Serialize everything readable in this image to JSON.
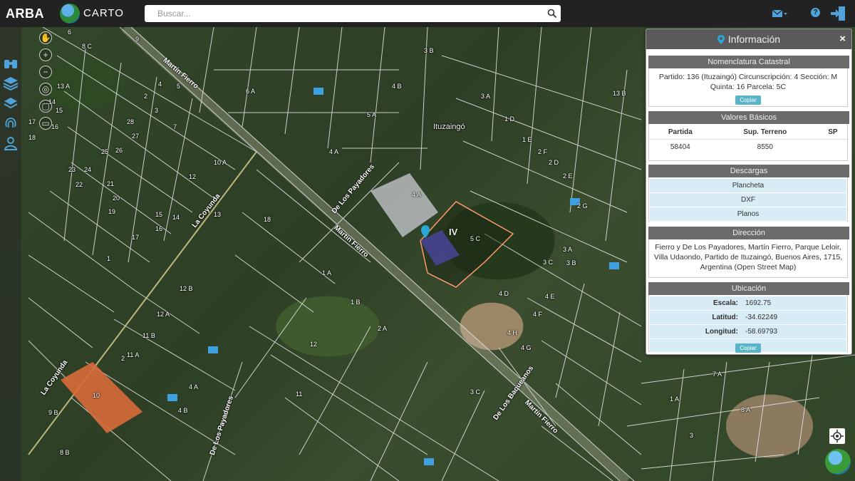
{
  "app": {
    "brand": "ARBA",
    "carto_name": "CARTO",
    "search_placeholder": "Buscar...",
    "icons": {
      "search": "search-icon",
      "mail": "mail-icon",
      "help": "help-icon",
      "logout": "logout-icon"
    },
    "help_glyph": "?",
    "colors": {
      "topbar": "#222222",
      "accent": "#4fa3d8",
      "panel_header": "#5a5a5a"
    }
  },
  "toolbar": {
    "items": [
      "binoculars-icon",
      "layers-icon",
      "layers-stack-icon",
      "fingerprint-icon",
      "user-location-icon"
    ]
  },
  "map": {
    "locality": "Ituzaingó",
    "zone": "IV",
    "streets": [
      "Martín Fierro",
      "La Coyunda",
      "De Los Payadores",
      "Martín Fierro",
      "De Los Payadores",
      "De Los Baqueanos",
      "Martín Fierro",
      "La Coyunda"
    ],
    "parcels": [
      "6",
      "8 C",
      "9",
      "13 A",
      "14",
      "15",
      "16",
      "17",
      "18",
      "4",
      "5",
      "3",
      "2",
      "28",
      "27",
      "26",
      "25",
      "24",
      "23",
      "22",
      "21",
      "20",
      "19",
      "6 A",
      "7",
      "10 A",
      "12",
      "13",
      "14",
      "15",
      "16",
      "17",
      "18",
      "1",
      "5 A",
      "4 A",
      "4 B",
      "3 B",
      "3 A",
      "1 D",
      "1 E",
      "2 F",
      "2 D",
      "2 E",
      "2 G",
      "3 A",
      "3 B",
      "3 C",
      "4 A",
      "5 C",
      "4 D",
      "4 E",
      "4 F",
      "4 H",
      "4 G",
      "1 A",
      "1 B",
      "2 A",
      "12",
      "11",
      "10",
      "9 B",
      "8 B",
      "4 A",
      "4 B",
      "3 C",
      "12 A",
      "12 B",
      "11 B",
      "11 A",
      "2",
      "1 A",
      "3",
      "7 A",
      "8 A",
      "13 B"
    ]
  },
  "info": {
    "title": "Información",
    "close": "×",
    "nomenclatura": {
      "header": "Nomenclatura Catastral",
      "line1": "Partido: 136 (Ituzaingó) Circunscripción: 4 Sección: M",
      "line2": "Quinta: 16 Parcela: 5C",
      "copy": "Copiar"
    },
    "valores": {
      "header": "Valores Básicos",
      "columns": [
        "Partida",
        "Sup. Terreno",
        "SP"
      ],
      "row": [
        "58404",
        "8550",
        ""
      ]
    },
    "descargas": {
      "header": "Descargas",
      "items": [
        "Plancheta",
        "DXF",
        "Planos"
      ]
    },
    "direccion": {
      "header": "Dirección",
      "text": "Fierro y De Los Payadores, Martín Fierro, Parque Leloir, Villa Udaondo, Partido de Ituzaingó, Buenos Aires, 1715, Argentina (Open Street Map)"
    },
    "ubicacion": {
      "header": "Ubicación",
      "escala_label": "Escala:",
      "escala": "1692.75",
      "latitud_label": "Latitud:",
      "latitud": "-34.62249",
      "longitud_label": "Longitud:",
      "longitud": "-58.69793",
      "copy": "Copiar"
    }
  }
}
